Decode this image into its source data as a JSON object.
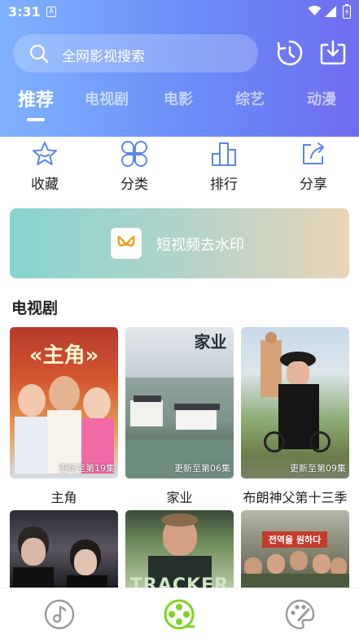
{
  "status_bar": {
    "time": "3:31",
    "sim_label": "A"
  },
  "header": {
    "search_placeholder": "全网影视搜索",
    "history_icon": "history-icon",
    "download_icon": "download-icon"
  },
  "tabs": [
    {
      "label": "推荐",
      "active": true
    },
    {
      "label": "电视剧",
      "active": false
    },
    {
      "label": "电影",
      "active": false
    },
    {
      "label": "综艺",
      "active": false
    },
    {
      "label": "动漫",
      "active": false
    }
  ],
  "quick_actions": [
    {
      "label": "收藏",
      "icon": "star-icon"
    },
    {
      "label": "分类",
      "icon": "category-icon"
    },
    {
      "label": "排行",
      "icon": "ranking-icon"
    },
    {
      "label": "分享",
      "icon": "share-icon"
    }
  ],
  "banner": {
    "text": "短视频去水印",
    "icon": "watermark-app-icon"
  },
  "section": {
    "title": "电视剧"
  },
  "shows": [
    {
      "title": "主角",
      "badge": "更新至第19集",
      "poster_text": "«主角»"
    },
    {
      "title": "家业",
      "badge": "更新至第06集",
      "poster_text": "家业"
    },
    {
      "title": "布朗神父第十三季",
      "badge": "更新至第09集",
      "poster_text": ""
    },
    {
      "title": "",
      "badge": "",
      "poster_text": ""
    },
    {
      "title": "",
      "badge": "",
      "poster_text": "TRACKER"
    },
    {
      "title": "",
      "badge": "",
      "poster_text": "전역을 원하다"
    }
  ],
  "bottom_nav": [
    {
      "icon": "music-disc-icon",
      "active": false
    },
    {
      "icon": "film-reel-icon",
      "active": true
    },
    {
      "icon": "palette-icon",
      "active": false
    }
  ],
  "colors": {
    "accent": "#6a8cf6",
    "active_nav": "#7ed321",
    "inactive_nav": "#9a9a9a"
  }
}
